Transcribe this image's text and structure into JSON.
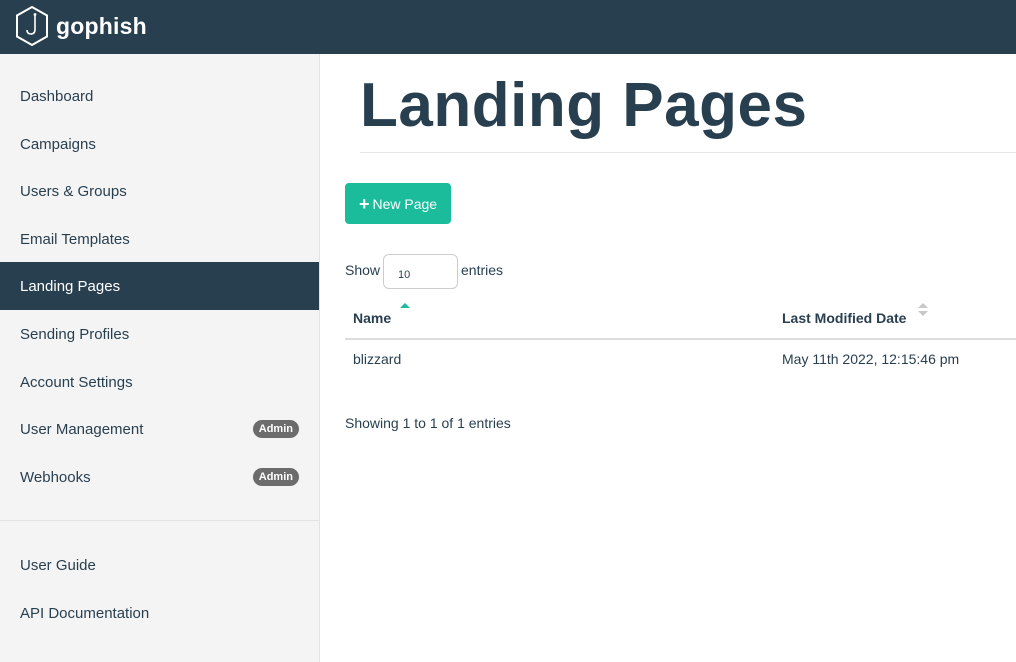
{
  "app": {
    "name": "gophish"
  },
  "sidebar": {
    "items": [
      {
        "label": "Dashboard"
      },
      {
        "label": "Campaigns"
      },
      {
        "label": "Users & Groups"
      },
      {
        "label": "Email Templates"
      },
      {
        "label": "Landing Pages",
        "active": true
      },
      {
        "label": "Sending Profiles"
      },
      {
        "label": "Account Settings"
      },
      {
        "label": "User Management",
        "badge": "Admin"
      },
      {
        "label": "Webhooks",
        "badge": "Admin"
      }
    ],
    "secondary": [
      {
        "label": "User Guide"
      },
      {
        "label": "API Documentation"
      }
    ]
  },
  "main": {
    "title": "Landing Pages",
    "new_button": {
      "icon": "plus-icon",
      "label": "New Page"
    },
    "table": {
      "length": {
        "prefix": "Show",
        "value": "10",
        "suffix": "entries"
      },
      "columns": [
        {
          "label": "Name",
          "sort": "ascending"
        },
        {
          "label": "Last Modified Date",
          "sort": "none"
        }
      ],
      "rows": [
        {
          "name": "blizzard",
          "modified": "May 11th 2022, 12:15:46 pm"
        }
      ],
      "info": "Showing 1 to 1 of 1 entries"
    }
  },
  "colors": {
    "navy": "#283f50",
    "accent": "#1abc9c",
    "badge": "#6c6c6c"
  }
}
